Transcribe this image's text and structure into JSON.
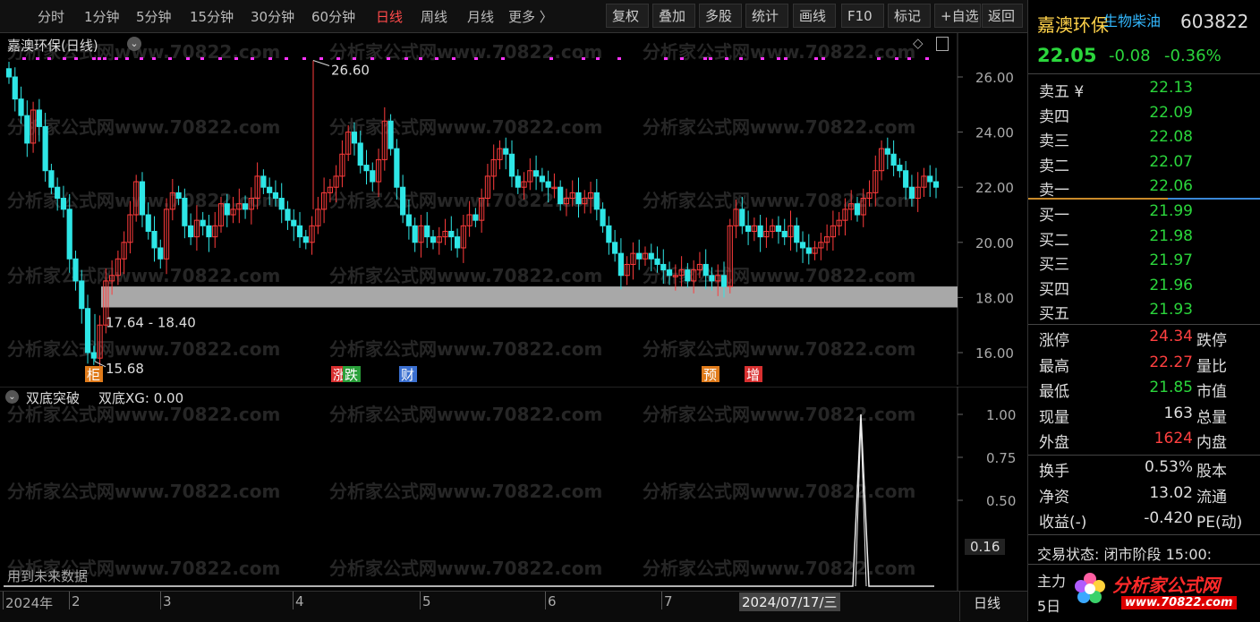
{
  "toolbar": {
    "timeframes": [
      "分时",
      "1分钟",
      "5分钟",
      "15分钟",
      "30分钟",
      "60分钟",
      "日线",
      "周线",
      "月线",
      "更多 〉"
    ],
    "active_timeframe": "日线",
    "buttons": [
      "复权",
      "叠加",
      "多股",
      "统计",
      "画线",
      "F10",
      "标记",
      "+自选",
      "返回"
    ]
  },
  "main": {
    "title": "嘉澳环保(日线)",
    "high_label": "26.60",
    "low_label": "15.68",
    "band_label": "17.64 - 18.40",
    "price_ticks": [
      "26.00",
      "24.00",
      "22.00",
      "20.00",
      "18.00",
      "16.00"
    ],
    "event_badges": [
      {
        "text": "柜",
        "color": "#e07b1a"
      },
      {
        "text": "涨",
        "color": "#d83030"
      },
      {
        "text": "跌",
        "color": "#2aa03a"
      },
      {
        "text": "财",
        "color": "#3a6fd0"
      },
      {
        "text": "预",
        "color": "#e07b1a"
      },
      {
        "text": "增",
        "color": "#d83030"
      }
    ],
    "watermark": "分析家公式网www.70822.com"
  },
  "indicator": {
    "title": "双底突破",
    "value_label": "双底XG: 0.00",
    "ticks": [
      "1.00",
      "0.75",
      "0.50"
    ],
    "current_value": "0.16",
    "footer_note": "用到未来数据"
  },
  "bottom_axis": {
    "labels": [
      "2024年",
      "2",
      "3",
      "4",
      "5",
      "6",
      "7"
    ],
    "cursor_date": "2024/07/17/三",
    "period": "日线"
  },
  "quote": {
    "name": "嘉澳环保",
    "sector": "生物柴油",
    "code": "603822",
    "price": "22.05",
    "change": "-0.08",
    "change_pct": "-0.36%",
    "asks": [
      {
        "label": "卖五 ¥",
        "price": "22.13"
      },
      {
        "label": "卖四",
        "price": "22.09"
      },
      {
        "label": "卖三",
        "price": "22.08"
      },
      {
        "label": "卖二",
        "price": "22.07"
      },
      {
        "label": "卖一",
        "price": "22.06"
      }
    ],
    "bids": [
      {
        "label": "买一",
        "price": "21.99"
      },
      {
        "label": "买二",
        "price": "21.98"
      },
      {
        "label": "买三",
        "price": "21.97"
      },
      {
        "label": "买四",
        "price": "21.96"
      },
      {
        "label": "买五",
        "price": "21.93"
      }
    ],
    "stats": [
      {
        "label": "涨停",
        "value": "24.34",
        "color": "red",
        "label2": "跌停"
      },
      {
        "label": "最高",
        "value": "22.27",
        "color": "red",
        "label2": "量比"
      },
      {
        "label": "最低",
        "value": "21.85",
        "color": "green",
        "label2": "市值"
      },
      {
        "label": "现量",
        "value": "163",
        "color": "white",
        "label2": "总量"
      },
      {
        "label": "外盘",
        "value": "1624",
        "color": "red",
        "label2": "内盘"
      }
    ],
    "stats2": [
      {
        "label": "换手",
        "value": "0.53%",
        "label2": "股本"
      },
      {
        "label": "净资",
        "value": "13.02",
        "label2": "流通"
      },
      {
        "label": "收益(-)",
        "value": "-0.420",
        "label2": "PE(动)"
      }
    ],
    "trade_status": "交易状态: 闭市阶段 15:00:",
    "main_force": "主力",
    "five_day": "5日",
    "brand": "分析家公式网",
    "brand_url": "www.70822.com"
  },
  "colors": {
    "up": "#ff3c3c",
    "down": "#2ee6e6",
    "magenta": "#ff33ff",
    "band": "#a8a8a8"
  }
}
